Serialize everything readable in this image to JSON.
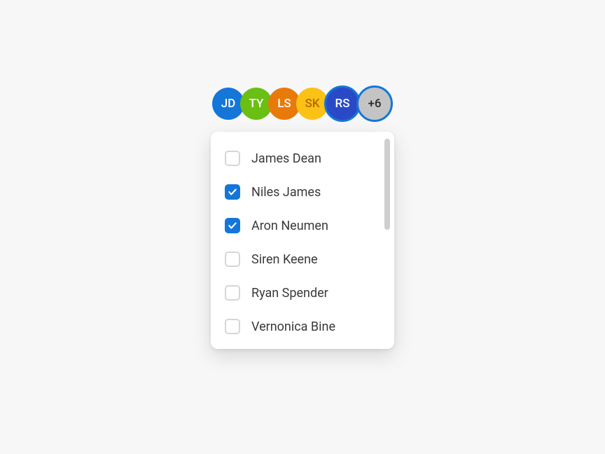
{
  "avatars": [
    {
      "initials": "JD",
      "bg": "#1476d8",
      "textColor": "#ffffff",
      "ringed": false
    },
    {
      "initials": "TY",
      "bg": "#6abf13",
      "textColor": "#ffffff",
      "ringed": false
    },
    {
      "initials": "LS",
      "bg": "#e87a0a",
      "textColor": "#ffffff",
      "ringed": false
    },
    {
      "initials": "SK",
      "bg": "#fbc115",
      "textColor": "#b86800",
      "ringed": false
    },
    {
      "initials": "RS",
      "bg": "#2a49c7",
      "textColor": "#ffffff",
      "ringed": true
    }
  ],
  "overflow_label": "+6",
  "list_items": [
    {
      "name": "James Dean",
      "checked": false
    },
    {
      "name": "Niles James",
      "checked": true
    },
    {
      "name": "Aron Neumen",
      "checked": true
    },
    {
      "name": "Siren Keene",
      "checked": false
    },
    {
      "name": "Ryan Spender",
      "checked": false
    },
    {
      "name": "Vernonica Bine",
      "checked": false
    }
  ]
}
